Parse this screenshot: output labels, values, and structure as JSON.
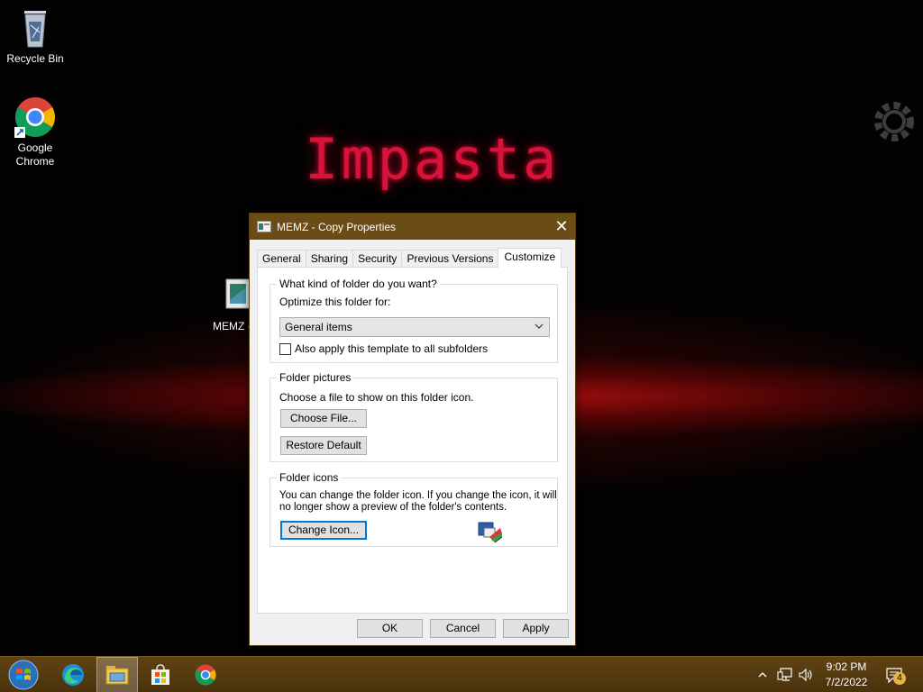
{
  "desktop": {
    "wallpaper_text": "Impasta",
    "icons": [
      {
        "label": "Recycle Bin"
      },
      {
        "label": "Google Chrome"
      },
      {
        "label": "MEMZ -"
      }
    ]
  },
  "dialog": {
    "title": "MEMZ - Copy Properties",
    "close_glyph": "✕",
    "tabs": [
      "General",
      "Sharing",
      "Security",
      "Previous Versions",
      "Customize"
    ],
    "active_tab": "Customize",
    "folder_type": {
      "legend": "What kind of folder do you want?",
      "optimize_label": "Optimize this folder for:",
      "selected": "General items",
      "subfolders_checkbox_label": "Also apply this template to all subfolders",
      "subfolders_checked": false
    },
    "folder_pictures": {
      "legend": "Folder pictures",
      "description": "Choose a file to show on this folder icon.",
      "choose_file_button": "Choose File...",
      "restore_default_button": "Restore Default"
    },
    "folder_icons": {
      "legend": "Folder icons",
      "description_line1": "You can change the folder icon. If you change the icon, it will",
      "description_line2": "no longer show a preview of the folder's contents.",
      "change_icon_button": "Change Icon..."
    },
    "buttons": {
      "ok": "OK",
      "cancel": "Cancel",
      "apply": "Apply"
    }
  },
  "taskbar": {
    "pinned": [
      "start-button",
      "edge-icon",
      "file-explorer-icon",
      "store-icon",
      "chrome-icon"
    ],
    "clock": {
      "time": "9:02 PM",
      "date": "7/2/2022"
    },
    "notification_count": "4"
  },
  "colors": {
    "titlebar": "#6b4c17",
    "taskbar": "#5f4313",
    "wallpaper_text": "#d8123a"
  }
}
